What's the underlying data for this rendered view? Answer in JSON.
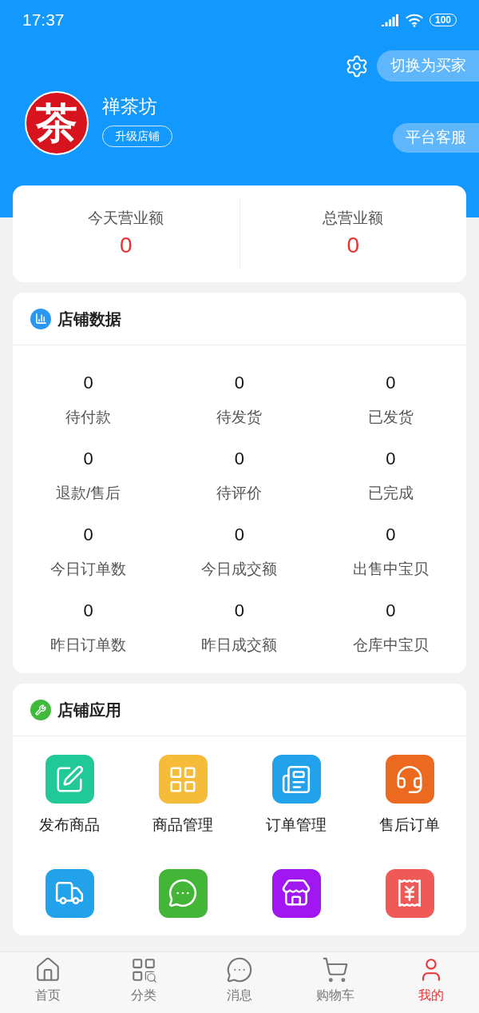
{
  "status_bar": {
    "time": "17:37",
    "battery": "100"
  },
  "header": {
    "switch_button": "切换为买家",
    "service_button": "平台客服"
  },
  "shop": {
    "logo_text": "茶",
    "name": "禅茶坊",
    "upgrade_button": "升级店铺"
  },
  "revenue": [
    {
      "label": "今天营业额",
      "value": "0"
    },
    {
      "label": "总营业额",
      "value": "0"
    }
  ],
  "store_data": {
    "title": "店铺数据",
    "stats": [
      {
        "value": "0",
        "label": "待付款"
      },
      {
        "value": "0",
        "label": "待发货"
      },
      {
        "value": "0",
        "label": "已发货"
      },
      {
        "value": "0",
        "label": "退款/售后"
      },
      {
        "value": "0",
        "label": "待评价"
      },
      {
        "value": "0",
        "label": "已完成"
      },
      {
        "value": "0",
        "label": "今日订单数"
      },
      {
        "value": "0",
        "label": "今日成交额"
      },
      {
        "value": "0",
        "label": "出售中宝贝"
      },
      {
        "value": "0",
        "label": "昨日订单数"
      },
      {
        "value": "0",
        "label": "昨日成交额"
      },
      {
        "value": "0",
        "label": "仓库中宝贝"
      }
    ]
  },
  "store_apps": {
    "title": "店铺应用",
    "apps": [
      {
        "kind": "publish",
        "label": "发布商品",
        "color": "#20c997"
      },
      {
        "kind": "goods",
        "label": "商品管理",
        "color": "#f6bb39"
      },
      {
        "kind": "orders",
        "label": "订单管理",
        "color": "#22a2ea"
      },
      {
        "kind": "aftersale",
        "label": "售后订单",
        "color": "#ec6a20"
      },
      {
        "kind": "delivery",
        "color": "#22a2ea"
      },
      {
        "kind": "chat",
        "color": "#43b537"
      },
      {
        "kind": "shop",
        "color": "#a117f2"
      },
      {
        "kind": "finance",
        "color": "#ef5a56"
      }
    ]
  },
  "tab_bar": [
    {
      "kind": "home",
      "label": "首页",
      "selected": false
    },
    {
      "kind": "category",
      "label": "分类",
      "selected": false
    },
    {
      "kind": "message",
      "label": "消息",
      "selected": false
    },
    {
      "kind": "cart",
      "label": "购物车",
      "selected": false
    },
    {
      "kind": "mine",
      "label": "我的",
      "selected": true
    }
  ]
}
